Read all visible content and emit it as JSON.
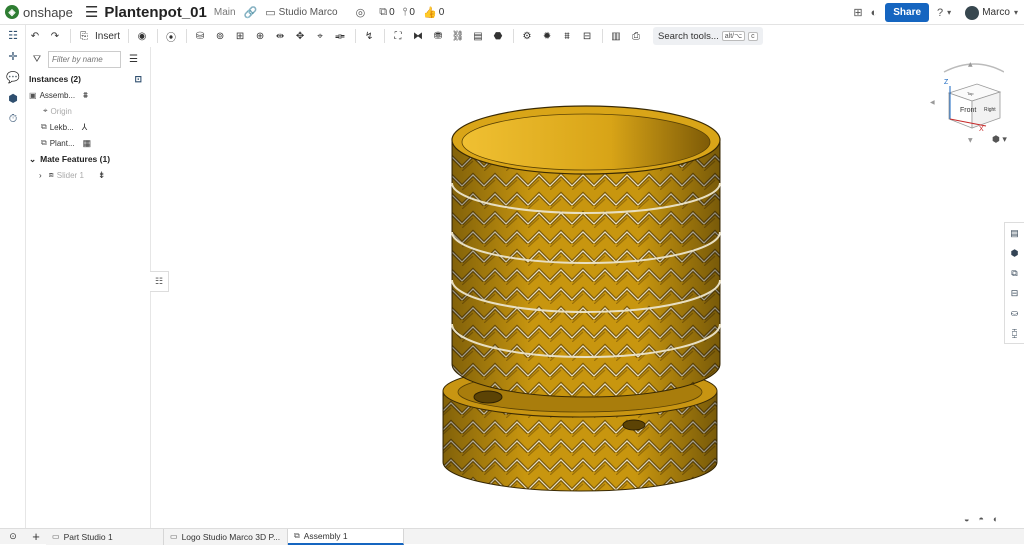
{
  "app": {
    "logo_text": "onshape",
    "logo_mark": "◈"
  },
  "document": {
    "title": "Plantenpot_01",
    "branch": "Main",
    "folder": "Studio Marco"
  },
  "header": {
    "versions_count": "0",
    "branches_count": "0",
    "likes_count": "0",
    "share_label": "Share",
    "user_name": "Marco"
  },
  "toolbar": {
    "insert_label": "Insert",
    "search_label": "Search tools...",
    "search_shortcut_1": "alt/⌥",
    "search_shortcut_2": "c"
  },
  "panel": {
    "filter_placeholder": "Filter by name",
    "instances_header": "Instances (2)",
    "instances": [
      {
        "label": "Assemb..."
      },
      {
        "label": "Origin"
      },
      {
        "label": "Lekb..."
      },
      {
        "label": "Plant..."
      }
    ],
    "mate_header": "Mate Features (1)",
    "mates": [
      {
        "label": "Slider 1"
      }
    ]
  },
  "viewcube": {
    "front": "Front",
    "right": "Right",
    "top": "Top",
    "axis_z": "Z",
    "axis_x": "X"
  },
  "tabs": [
    {
      "label": "Part Studio 1",
      "active": false
    },
    {
      "label": "Logo Studio Marco 3D P...",
      "active": false
    },
    {
      "label": "Assembly 1",
      "active": true
    }
  ],
  "colors": {
    "accent": "#1565c0",
    "model_gold": "#d4a216",
    "model_dark": "#8a6508"
  }
}
